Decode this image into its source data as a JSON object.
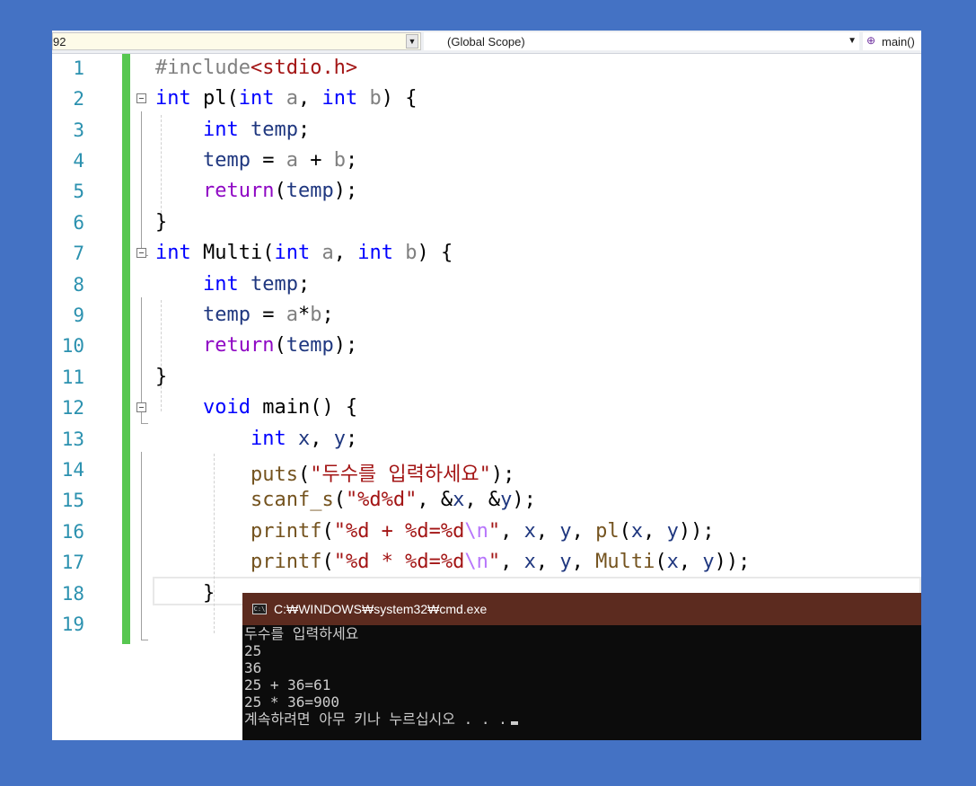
{
  "navbar": {
    "project_combo": "92",
    "scope_combo": "(Global Scope)",
    "member_combo": "main()"
  },
  "editor": {
    "line_numbers": [
      "1",
      "2",
      "3",
      "4",
      "5",
      "6",
      "7",
      "8",
      "9",
      "10",
      "11",
      "12",
      "13",
      "14",
      "15",
      "16",
      "17",
      "18",
      "19"
    ],
    "lines": [
      "#include<stdio.h>",
      "int pl(int a, int b) {",
      "    int temp;",
      "    temp = a + b;",
      "    return(temp);",
      "}",
      "int Multi(int a, int b) {",
      "    int temp;",
      "    temp = a*b;",
      "    return(temp);",
      "}",
      "    void main() {",
      "        int x, y;",
      "        puts(\"두수를 입력하세요\");",
      "        scanf_s(\"%d%d\", &x, &y);",
      "        printf(\"%d + %d=%d\\n\", x, y, pl(x, y));",
      "        printf(\"%d * %d=%d\\n\", x, y, Multi(x, y));",
      "    }",
      ""
    ]
  },
  "console": {
    "title": "C:₩WINDOWS₩system32₩cmd.exe",
    "icon_text": "C:\\",
    "lines": [
      "두수를 입력하세요",
      "25",
      "36",
      "25 + 36=61",
      "25 * 36=900",
      "계속하려면 아무 키나 누르십시오 . . ."
    ]
  },
  "colors": {
    "background": "#4472c4",
    "keyword": "#0000ff",
    "string": "#a31515",
    "control": "#8f08c4",
    "line_number": "#2b91af",
    "change_bar": "#57c750",
    "console_title_bg": "#5c2b1f"
  },
  "icons": {
    "scope_dropdown": "chevron-down-icon",
    "member": "member-function-icon",
    "console": "cmd-icon"
  }
}
